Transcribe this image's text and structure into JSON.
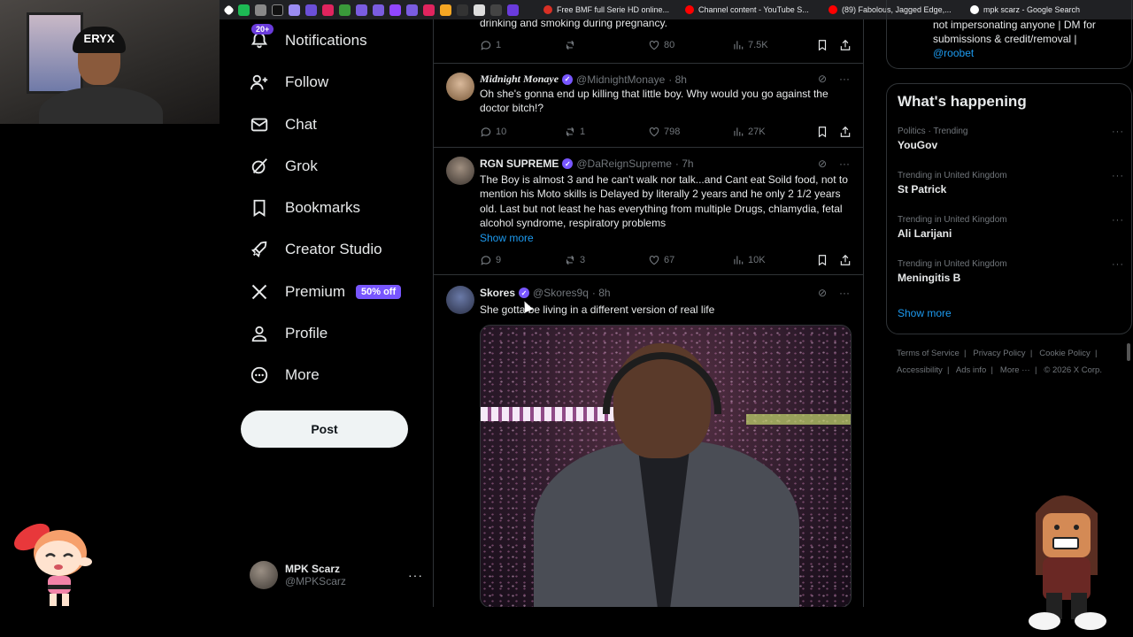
{
  "browser_tabs": [
    {
      "title": "Free BMF full Serie HD online...",
      "color": "#d93025"
    },
    {
      "title": "Channel content - YouTube S...",
      "color": "#ff0000"
    },
    {
      "title": "(89) Fabolous, Jagged Edge,...",
      "color": "#ff0000"
    },
    {
      "title": "mpk scarz - Google Search",
      "color": "#ffffff"
    }
  ],
  "webcam": {
    "beanie_text": "ERYX"
  },
  "sidebar": {
    "notifications_badge": "20+",
    "items": [
      {
        "label": "Notifications",
        "icon": "bell-icon"
      },
      {
        "label": "Follow",
        "icon": "person-add-icon"
      },
      {
        "label": "Chat",
        "icon": "mail-icon"
      },
      {
        "label": "Grok",
        "icon": "grok-icon"
      },
      {
        "label": "Bookmarks",
        "icon": "bookmark-icon"
      },
      {
        "label": "Creator Studio",
        "icon": "rocket-icon"
      },
      {
        "label": "Premium",
        "icon": "x-logo-icon"
      },
      {
        "label": "Profile",
        "icon": "person-icon"
      },
      {
        "label": "More",
        "icon": "more-circle-icon"
      }
    ],
    "premium_promo": "50% off",
    "post_label": "Post",
    "account": {
      "name": "MPK Scarz",
      "handle": "@MPKScarz"
    }
  },
  "timeline": {
    "tweet0": {
      "partial_text": "drinking and smoking during pregnancy.",
      "replies": "1",
      "reposts": "",
      "likes": "80",
      "views": "7.5K"
    },
    "tweet1": {
      "name": "Midnight Monaye",
      "handle": "@MidnightMonaye",
      "time": "· 8h",
      "text": "Oh she's gonna end up killing that little boy. Why would you go against the doctor bitch!?",
      "replies": "10",
      "reposts": "1",
      "likes": "798",
      "views": "27K"
    },
    "tweet2": {
      "name": "RGN SUPREME",
      "handle": "@DaReignSupreme",
      "time": "· 7h",
      "text": "The Boy is almost 3 and he can't walk nor talk...and Cant eat Soild food, not to mention his Moto skills is Delayed  by literally 2 years and he only 2 1/2 years old. Last but not least he has everything from multiple Drugs, chlamydia, fetal alcohol syndrome, respiratory problems",
      "show_more": "Show more",
      "replies": "9",
      "reposts": "3",
      "likes": "67",
      "views": "10K"
    },
    "tweet3": {
      "name": "Skores",
      "handle": "@Skores9q",
      "time": "· 8h",
      "text": "She gotta be living in a different version of real life"
    }
  },
  "right": {
    "who_text": "not impersonating anyone | DM for submissions & credit/removal |",
    "who_link": "@roobet",
    "trends_title": "What's happening",
    "trends": [
      {
        "context": "Politics · Trending",
        "name": "YouGov"
      },
      {
        "context": "Trending in United Kingdom",
        "name": "St Patrick"
      },
      {
        "context": "Trending in United Kingdom",
        "name": "Ali Larijani"
      },
      {
        "context": "Trending in United Kingdom",
        "name": "Meningitis B"
      }
    ],
    "show_more": "Show more",
    "footer": {
      "terms": "Terms of Service",
      "privacy": "Privacy Policy",
      "cookie": "Cookie Policy",
      "accessibility": "Accessibility",
      "ads": "Ads info",
      "more": "More ···",
      "copyright": "© 2026 X Corp."
    }
  }
}
